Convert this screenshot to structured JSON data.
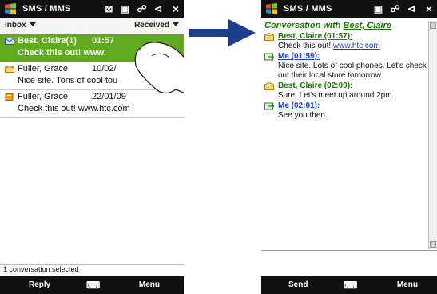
{
  "left": {
    "statusbar": {
      "title": "SMS / MMS",
      "icons": "⊠ ▣ ☍ ⊲",
      "close": "×"
    },
    "filter": {
      "left": "Inbox",
      "right": "Received"
    },
    "messages": [
      {
        "name": "Best, Claire(1)",
        "date": "01:57",
        "preview": "Check this out! www.",
        "selected": true,
        "icon": "envelope-icon"
      },
      {
        "name": "Fuller, Grace",
        "date": "10/02/",
        "preview": "Nice site. Tons of cool tou",
        "selected": false,
        "icon": "envelope-open-icon"
      },
      {
        "name": "Fuller, Grace",
        "date": "22/01/09",
        "preview": "Check this out! www.htc.com",
        "selected": false,
        "icon": "message-icon"
      }
    ],
    "status": "1 conversation selected",
    "softkeys": {
      "left": "Reply",
      "right": "Menu",
      "keyboard": "⌨"
    }
  },
  "right": {
    "statusbar": {
      "title": "SMS / MMS",
      "icons": "▣ ☍ ⊲",
      "close": "×"
    },
    "conversation_with_label": "Conversation with",
    "conversation_with_name": "Best, Claire",
    "entries": [
      {
        "head": "Best, Claire (01:57):",
        "body_pre": "Check this out! ",
        "link": "www.htc.com",
        "kind": "inbox"
      },
      {
        "head": "Me (01:59):",
        "body_pre": "Nice site. Lots of cool phones. Let's check out their local store tomorrow.",
        "link": "",
        "kind": "me"
      },
      {
        "head": "Best, Claire (02:00):",
        "body_pre": "Sure. Let's meet up around 2pm.",
        "link": "",
        "kind": "inbox"
      },
      {
        "head": "Me (02:01):",
        "body_pre": "See you then.",
        "link": "",
        "kind": "me"
      }
    ],
    "softkeys": {
      "left": "Send",
      "right": "Menu",
      "keyboard": "⌨"
    }
  },
  "colors": {
    "selected_green": "#5faa1e",
    "arrow_blue": "#1b3f8c",
    "link_blue": "#1a3bd6",
    "conv_green": "#1a7a00"
  }
}
